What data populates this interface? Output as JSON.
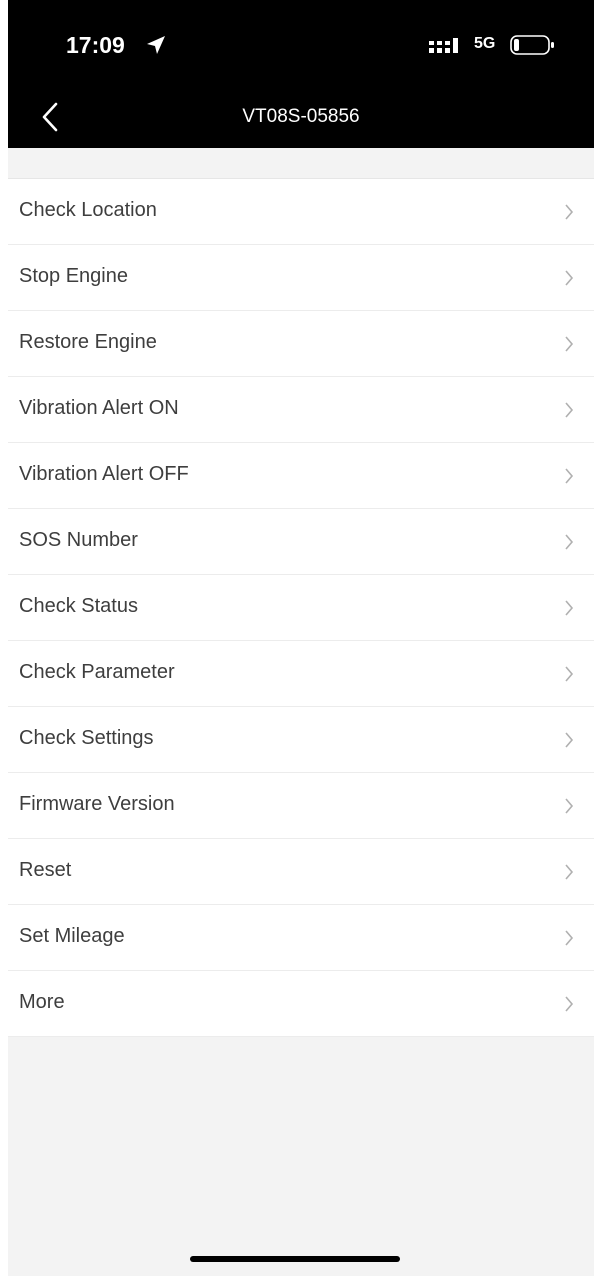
{
  "status_bar": {
    "time": "17:09",
    "network": "5G",
    "location_icon": "location-arrow-icon",
    "signal_icon": "cellular-signal-icon",
    "battery_icon": "battery-low-icon"
  },
  "nav": {
    "title": "VT08S-05856",
    "back_icon": "chevron-left-icon"
  },
  "menu": {
    "items": [
      {
        "label": "Check Location"
      },
      {
        "label": "Stop Engine"
      },
      {
        "label": "Restore Engine"
      },
      {
        "label": "Vibration Alert ON"
      },
      {
        "label": "Vibration Alert OFF"
      },
      {
        "label": "SOS Number"
      },
      {
        "label": "Check Status"
      },
      {
        "label": "Check Parameter"
      },
      {
        "label": "Check Settings"
      },
      {
        "label": "Firmware Version"
      },
      {
        "label": "Reset"
      },
      {
        "label": "Set Mileage"
      },
      {
        "label": "More"
      }
    ],
    "chevron_icon": "chevron-right-icon"
  },
  "colors": {
    "header_background": "#000000",
    "page_background": "#f3f3f3",
    "row_background": "#ffffff",
    "text": "#3e3e3e",
    "chevron": "#b0b0b0"
  }
}
